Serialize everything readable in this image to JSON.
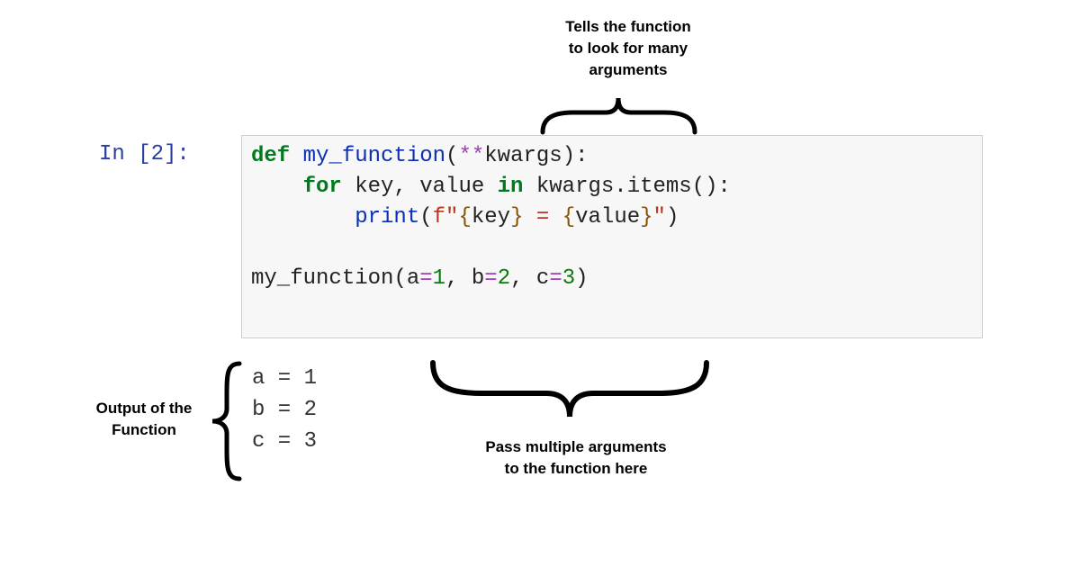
{
  "annotations": {
    "top": "Tells the function\nto look for many\narguments",
    "output": "Output of the\nFunction",
    "bottom": "Pass multiple arguments\nto the function here"
  },
  "prompt": "In [2]:",
  "code": {
    "l1_def": "def",
    "l1_fn": " my_function",
    "l1_paren_open": "(",
    "l1_stars": "**",
    "l1_kwargs": "kwargs",
    "l1_paren_close": ")",
    "l1_colon": ":",
    "l2_indent": "    ",
    "l2_for": "for",
    "l2_loop": " key, value ",
    "l2_in": "in",
    "l2_expr": " kwargs.items():",
    "l3_indent": "        ",
    "l3_print": "print",
    "l3_open": "(",
    "l3_f": "f\"",
    "l3_b1": "{",
    "l3_k": "key",
    "l3_b2": "}",
    "l3_mid": " = ",
    "l3_b3": "{",
    "l3_v": "value",
    "l3_b4": "}",
    "l3_qclose": "\"",
    "l3_close": ")",
    "l5_call_fn": "my_function",
    "l5_open": "(",
    "l5_a": "a",
    "l5_eq1": "=",
    "l5_n1": "1",
    "l5_c1": ", ",
    "l5_b": "b",
    "l5_eq2": "=",
    "l5_n2": "2",
    "l5_c2": ", ",
    "l5_cc": "c",
    "l5_eq3": "=",
    "l5_n3": "3",
    "l5_close": ")"
  },
  "output": {
    "l1": "a = 1",
    "l2": "b = 2",
    "l3": "c = 3"
  }
}
